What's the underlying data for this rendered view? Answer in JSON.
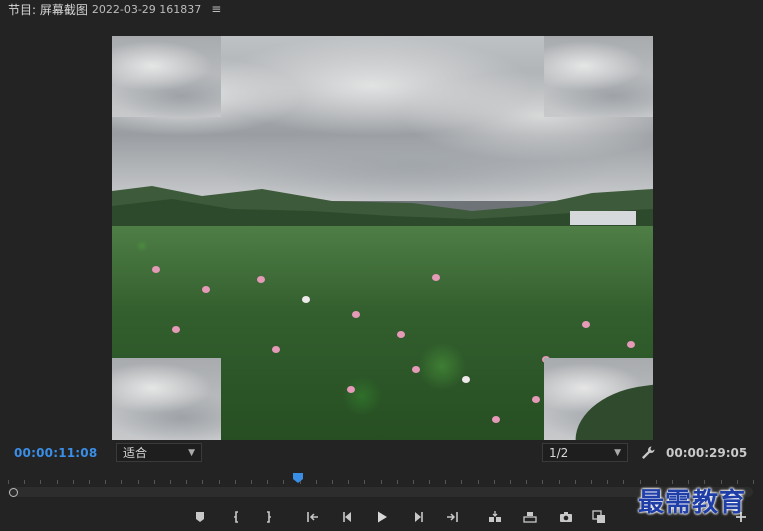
{
  "panel": {
    "title": "节目: 屏幕截图",
    "subtitle": "2022-03-29 161837"
  },
  "icons": {
    "panel_menu": "hamburger-icon",
    "settings": "wrench-icon",
    "playhead": "playhead-marker-icon"
  },
  "viewer": {
    "fit_label": "适合",
    "resolution_label": "1/2"
  },
  "timecode": {
    "current": "00:00:11:08",
    "duration": "00:00:29:05"
  },
  "playback": {
    "progress_fraction": 0.389
  },
  "colors": {
    "accent": "#3a8ee6",
    "background": "#232323",
    "watermark": "#1f3ea8"
  },
  "watermark": {
    "text": "最需教育"
  }
}
